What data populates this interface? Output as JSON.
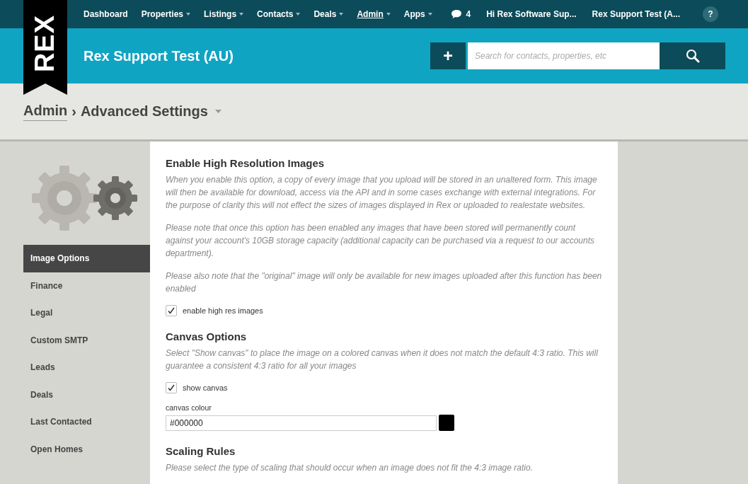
{
  "top_nav": {
    "logo": "REX",
    "items": [
      {
        "label": "Dashboard",
        "has_menu": false,
        "selected": false
      },
      {
        "label": "Properties",
        "has_menu": true,
        "selected": false
      },
      {
        "label": "Listings",
        "has_menu": true,
        "selected": false
      },
      {
        "label": "Contacts",
        "has_menu": true,
        "selected": false
      },
      {
        "label": "Deals",
        "has_menu": true,
        "selected": false
      },
      {
        "label": "Admin",
        "has_menu": true,
        "selected": true
      },
      {
        "label": "Apps",
        "has_menu": true,
        "selected": false
      }
    ],
    "messages_count": "4",
    "greeting": "Hi Rex Software Sup...",
    "account": "Rex Support Test (A...",
    "help": "?"
  },
  "header": {
    "title": "Rex Support Test (AU)",
    "add_button": "+",
    "search": {
      "placeholder": "Search for contacts, properties, etc"
    }
  },
  "breadcrumb": {
    "parent": "Admin",
    "separator": "›",
    "current": "Advanced Settings"
  },
  "sidebar": {
    "items": [
      {
        "label": "Image Options",
        "selected": true
      },
      {
        "label": "Finance",
        "selected": false
      },
      {
        "label": "Legal",
        "selected": false
      },
      {
        "label": "Custom SMTP",
        "selected": false
      },
      {
        "label": "Leads",
        "selected": false
      },
      {
        "label": "Deals",
        "selected": false
      },
      {
        "label": "Last Contacted",
        "selected": false
      },
      {
        "label": "Open Homes",
        "selected": false
      }
    ]
  },
  "sections": [
    {
      "title": "Enable High Resolution Images",
      "paragraphs": [
        "When you enable this option, a copy of every image that you upload will be stored in an unaltered form. This image will then be available for download, access via the API and in some cases exchange with external integrations. For the purpose of clarity this will not effect the sizes of images displayed in Rex or uploaded to realestate websites.",
        "Please note that once this option has been enabled any images that have been stored will permanently count against your account's 10GB storage capacity (additional capacity can be purchased via a request to our accounts department).",
        "Please also note that the \"original\" image will only be available for new images uploaded after this function has been enabled"
      ],
      "checkbox": {
        "label": "enable high res images",
        "checked": true
      }
    },
    {
      "title": "Canvas Options",
      "paragraphs": [
        "Select \"Show canvas\" to place the image on a colored canvas when it does not match the default 4:3 ratio. This will guarantee a consistent 4:3 ratio for all your images"
      ],
      "checkbox": {
        "label": "show canvas",
        "checked": true
      },
      "color_field": {
        "label": "canvas colour",
        "value": "#000000"
      }
    },
    {
      "title": "Scaling Rules",
      "paragraphs": [
        "Please select the type of scaling that should occur when an image does not fit the 4:3 image ratio."
      ]
    }
  ]
}
